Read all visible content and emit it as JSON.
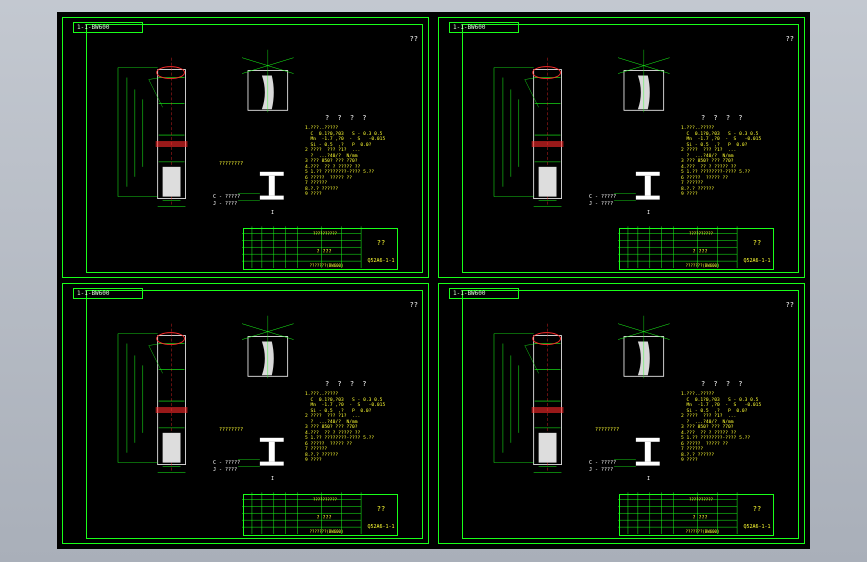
{
  "sheets": [
    {
      "title": "1-1-BW600",
      "corner": "??",
      "notes_title": "? ? ? ?",
      "notes": [
        "1.???..?????",
        "  C  0.1?0,?03   S - 0.3 0.5",
        "  Mn  -1.7 ,?0  -  S   -0.015",
        "  Si - 0.5  ,?   P  0.0?",
        "2 ????  ??? ?1?  ...",
        "  ?  ...?40/?  N/mm",
        "3 ??? 850? ??? ?70?",
        "4.???  ?? ? ????? ??",
        "5 1.?? ????????-???? 5.??",
        "6 ?????  ????? ??",
        "7 ??????",
        "8.?.? ??????",
        "9 ????"
      ],
      "section_caption": "????????",
      "section_legends": [
        "C - ?????",
        "J - ????"
      ],
      "section_label": "I",
      "title_block": {
        "company": "??????????",
        "name": "??",
        "mid": "?  ???",
        "code": "Q52A6-1-1",
        "bottom": "???????(BW600)"
      }
    },
    {
      "title": "1-1-BW600",
      "corner": "??",
      "notes_title": "? ? ? ?",
      "notes": [
        "1.???..?????",
        "  C  0.1?0,?03   S - 0.3 0.5",
        "  Mn  -1.7 ,?0  -  S   -0.015",
        "  Si - 0.5  ,?   P  0.0?",
        "2 ????  ??? ?1?  ...",
        "  ?  ...?40/?  N/mm",
        "3 ??? 850? ??? ?70?",
        "4.???  ?? ? ????? ??",
        "5 1.?? ????????-???? 5.??",
        "6 ?????  ????? ??",
        "7 ??????",
        "8.?.? ??????",
        "9 ????"
      ],
      "section_caption": "",
      "section_legends": [
        "C - ?????",
        "J - ????"
      ],
      "section_label": "I",
      "title_block": {
        "company": "??????????",
        "name": "??",
        "mid": "?  ???",
        "code": "Q52A6-1-1",
        "bottom": "???????(BW600)"
      }
    },
    {
      "title": "1-1-BW600",
      "corner": "??",
      "notes_title": "? ? ? ?",
      "notes": [
        "1.???..?????",
        "  C  0.1?0,?03   S - 0.3 0.5",
        "  Mn  -1.7 ,?0  -  S   -0.015",
        "  Si - 0.5  ,?   P  0.0?",
        "2 ????  ??? ?1?  ...",
        "  ?  ...?40/?  N/mm",
        "3 ??? 850? ??? ?70?",
        "4.???  ?? ? ????? ??",
        "5 1.?? ????????-???? 5.??",
        "6 ?????  ????? ??",
        "7 ??????",
        "8.?.? ??????",
        "9 ????"
      ],
      "section_caption": "????????",
      "section_legends": [
        "C - ?????",
        "J - ????"
      ],
      "section_label": "I",
      "title_block": {
        "company": "??????????",
        "name": "??",
        "mid": "?  ???",
        "code": "Q52A6-1-1",
        "bottom": "???????(BW600)"
      }
    },
    {
      "title": "1-1-BW600",
      "corner": "??",
      "notes_title": "? ? ? ?",
      "notes": [
        "1.???..?????",
        "  C  0.1?0,?03   S - 0.3 0.5",
        "  Mn  -1.7 ,?0  -  S   -0.015",
        "  Si - 0.5  ,?   P  0.0?",
        "2 ????  ??? ?1?  ...",
        "  ?  ...?40/?  N/mm",
        "3 ??? 850? ??? ?70?",
        "4.???  ?? ? ????? ??",
        "5 1.?? ????????-???? 5.??",
        "6 ?????  ????? ??",
        "7 ??????",
        "8.?.? ??????",
        "9 ????"
      ],
      "section_caption": "????????",
      "section_legends": [
        "C - ?????",
        "J - ????"
      ],
      "section_label": "I",
      "title_block": {
        "company": "??????????",
        "name": "??",
        "mid": "?  ???",
        "code": "Q52A6-1-1",
        "bottom": "???????(BW600)"
      }
    }
  ],
  "colors": {
    "frame": "#19ff19",
    "text_yellow": "#ffff33",
    "text_white": "#ffffff",
    "highlight": "#ff2a2a",
    "section_fill": "#ffffff",
    "background": "#000000"
  }
}
